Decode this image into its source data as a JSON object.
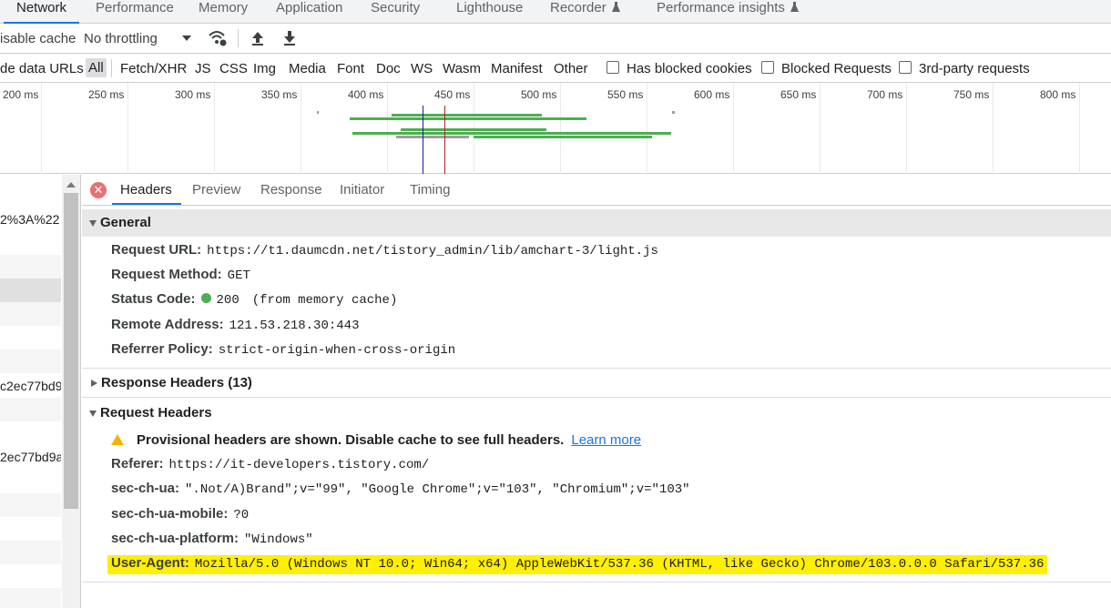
{
  "panel_tabs": [
    "Network",
    "Performance",
    "Memory",
    "Application",
    "Security",
    "Lighthouse",
    "Recorder",
    "Performance insights"
  ],
  "toolbar": {
    "disable_cache": "isable cache",
    "throttling": "No throttling"
  },
  "filters": {
    "hide_data_urls": "de data URLs",
    "types": [
      "All",
      "Fetch/XHR",
      "JS",
      "CSS",
      "Img",
      "Media",
      "Font",
      "Doc",
      "WS",
      "Wasm",
      "Manifest",
      "Other"
    ],
    "checkboxes": [
      "Has blocked cookies",
      "Blocked Requests",
      "3rd-party requests"
    ]
  },
  "timeline_ticks": [
    "200 ms",
    "250 ms",
    "300 ms",
    "350 ms",
    "400 ms",
    "450 ms",
    "500 ms",
    "550 ms",
    "600 ms",
    "650 ms",
    "700 ms",
    "750 ms",
    "800 ms"
  ],
  "request_list": {
    "rows": [
      "2%3A%22",
      "",
      "",
      "",
      "",
      "",
      "c2ec77bd9",
      "",
      "2ec77bd9a",
      "",
      "",
      "",
      "",
      "",
      "",
      "",
      ""
    ]
  },
  "detail_tabs": [
    "Headers",
    "Preview",
    "Response",
    "Initiator",
    "Timing"
  ],
  "general": {
    "title": "General",
    "request_url_key": "Request URL:",
    "request_url": "https://t1.daumcdn.net/tistory_admin/lib/amchart-3/light.js",
    "method_key": "Request Method:",
    "method": "GET",
    "status_key": "Status Code:",
    "status": "200",
    "status_note": "(from memory cache)",
    "remote_key": "Remote Address:",
    "remote": "121.53.218.30:443",
    "referrer_policy_key": "Referrer Policy:",
    "referrer_policy": "strict-origin-when-cross-origin"
  },
  "response_headers": {
    "title": "Response Headers (13)"
  },
  "request_headers": {
    "title": "Request Headers",
    "warning": "Provisional headers are shown. Disable cache to see full headers.",
    "learn_more": "Learn more",
    "referer_key": "Referer:",
    "referer": "https://it-developers.tistory.com/",
    "ua_key": "sec-ch-ua:",
    "ua": "\".Not/A)Brand\";v=\"99\", \"Google Chrome\";v=\"103\", \"Chromium\";v=\"103\"",
    "mobile_key": "sec-ch-ua-mobile:",
    "mobile": "?0",
    "platform_key": "sec-ch-ua-platform:",
    "platform": "\"Windows\"",
    "user_agent_key": "User-Agent:",
    "user_agent": "Mozilla/5.0 (Windows NT 10.0; Win64; x64) AppleWebKit/537.36 (KHTML, like Gecko) Chrome/103.0.0.0 Safari/537.36"
  },
  "colors": {
    "accent": "#1a73e8",
    "status_ok": "#4caf50",
    "highlight": "#ffef00"
  }
}
